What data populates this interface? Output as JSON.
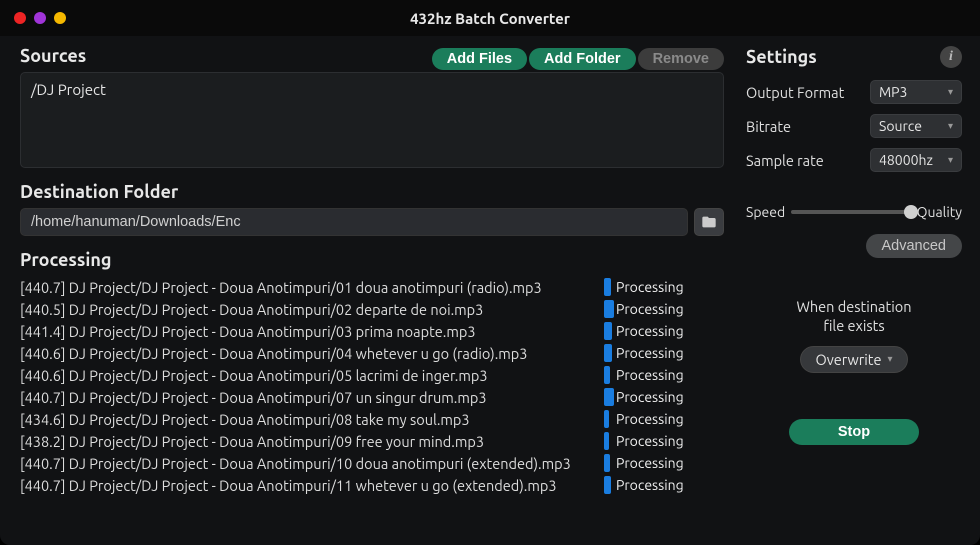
{
  "window": {
    "title": "432hz Batch Converter"
  },
  "sources": {
    "title": "Sources",
    "add_files": "Add Files",
    "add_folder": "Add Folder",
    "remove": "Remove",
    "items": [
      "/DJ Project"
    ]
  },
  "destination": {
    "title": "Destination Folder",
    "path": "/home/hanuman/Downloads/Enc"
  },
  "processing": {
    "title": "Processing",
    "status_label": "Processing",
    "items": [
      {
        "hz": "[440.7]",
        "name": "DJ Project/DJ Project - Doua Anotimpuri/01 doua anotimpuri (radio).mp3",
        "progress": 6
      },
      {
        "hz": "[440.5]",
        "name": "DJ Project/DJ Project - Doua Anotimpuri/02 departe de noi.mp3",
        "progress": 8
      },
      {
        "hz": "[441.4]",
        "name": "DJ Project/DJ Project - Doua Anotimpuri/03 prima noapte.mp3",
        "progress": 7
      },
      {
        "hz": "[440.6]",
        "name": "DJ Project/DJ Project - Doua Anotimpuri/04 whetever u go (radio).mp3",
        "progress": 7
      },
      {
        "hz": "[440.6]",
        "name": "DJ Project/DJ Project - Doua Anotimpuri/05 lacrimi de inger.mp3",
        "progress": 5
      },
      {
        "hz": "[440.7]",
        "name": "DJ Project/DJ Project - Doua Anotimpuri/07 un singur drum.mp3",
        "progress": 8
      },
      {
        "hz": "[434.6]",
        "name": "DJ Project/DJ Project - Doua Anotimpuri/08 take my soul.mp3",
        "progress": 4
      },
      {
        "hz": "[438.2]",
        "name": "DJ Project/DJ Project - Doua Anotimpuri/09 free your mind.mp3",
        "progress": 4
      },
      {
        "hz": "[440.7]",
        "name": "DJ Project/DJ Project - Doua Anotimpuri/10 doua anotimpuri (extended).mp3",
        "progress": 5
      },
      {
        "hz": "[440.7]",
        "name": "DJ Project/DJ Project - Doua Anotimpuri/11 whetever u go (extended).mp3",
        "progress": 6
      }
    ]
  },
  "settings": {
    "title": "Settings",
    "output_format": {
      "label": "Output Format",
      "value": "MP3"
    },
    "bitrate": {
      "label": "Bitrate",
      "value": "Source"
    },
    "sample_rate": {
      "label": "Sample rate",
      "value": "48000hz"
    },
    "speed_label": "Speed",
    "quality_label": "Quality",
    "advanced": "Advanced",
    "dest_exists_line1": "When destination",
    "dest_exists_line2": "file exists",
    "overwrite": "Overwrite",
    "stop": "Stop"
  }
}
